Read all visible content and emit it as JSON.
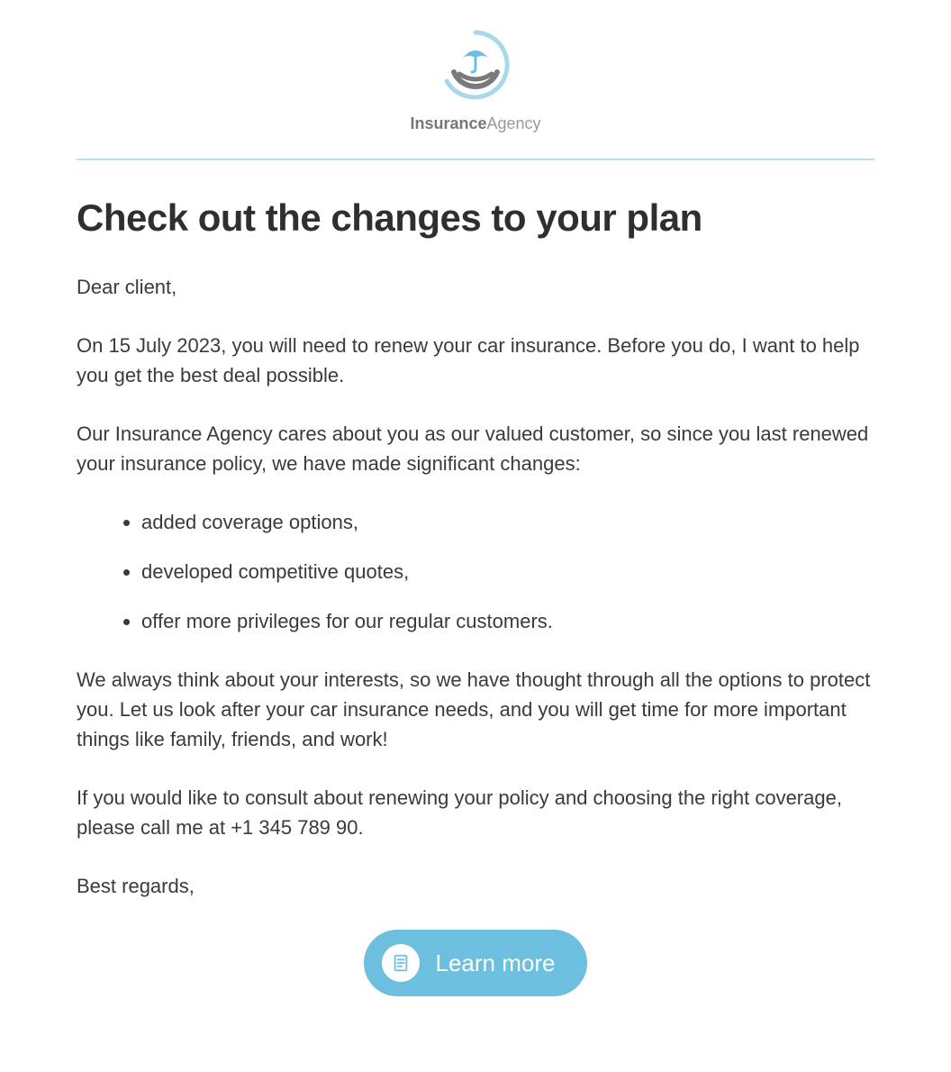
{
  "brand": {
    "bold": "Insurance",
    "light": "Agency"
  },
  "title": "Check out the changes to your plan",
  "greeting": "Dear client,",
  "paragraph1": "On 15 July 2023, you will need to renew your car insurance. Before you do, I want to help you get the best deal possible.",
  "paragraph2": "Our Insurance Agency cares about you as our valued customer, so since you last renewed your insurance policy, we have made significant changes:",
  "bullets": [
    "added coverage options,",
    "developed competitive quotes,",
    "offer more privileges for our regular customers."
  ],
  "paragraph3": "We always think about your interests, so we have thought through all the options to protect you. Let us look after your car insurance needs, and you will get time for more important things like family, friends, and work!",
  "paragraph4": "If you would like to consult about renewing your policy and choosing the right coverage, please call me at +1 345 789 90.",
  "signoff": "Best regards,",
  "cta_label": "Learn more",
  "colors": {
    "accent": "#6dbfe0",
    "divider": "#b8dff0"
  }
}
